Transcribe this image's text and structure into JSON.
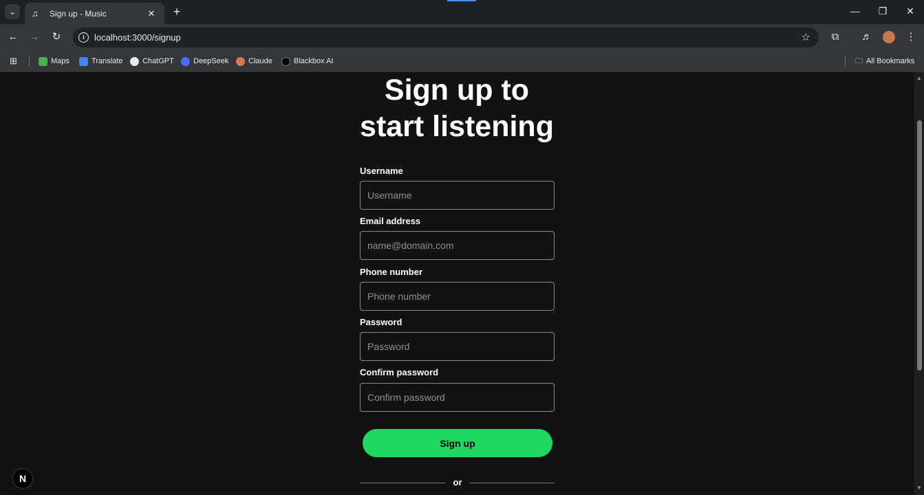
{
  "browser": {
    "tab": {
      "title": "Sign up - Music",
      "favicon": "music-note-icon"
    },
    "url": "localhost:3000/signup",
    "bookmarks": [
      {
        "label": "Maps",
        "icon": "maps-icon",
        "color": "#4caf50"
      },
      {
        "label": "Translate",
        "icon": "translate-icon",
        "color": "#4285f4"
      },
      {
        "label": "ChatGPT",
        "icon": "chatgpt-icon",
        "color": "#e8eaed"
      },
      {
        "label": "DeepSeek",
        "icon": "deepseek-icon",
        "color": "#4d6bfe"
      },
      {
        "label": "Claude",
        "icon": "claude-icon",
        "color": "#d97757"
      },
      {
        "label": "Blackbox AI",
        "icon": "blackbox-icon",
        "color": "#000000"
      }
    ],
    "all_bookmarks": "All Bookmarks"
  },
  "page": {
    "heading_line1": "Sign up to",
    "heading_line2": "start listening",
    "fields": [
      {
        "label": "Username",
        "placeholder": "Username",
        "value": ""
      },
      {
        "label": "Email address",
        "placeholder": "name@domain.com",
        "value": ""
      },
      {
        "label": "Phone number",
        "placeholder": "Phone number",
        "value": ""
      },
      {
        "label": "Password",
        "placeholder": "Password",
        "value": ""
      },
      {
        "label": "Confirm password",
        "placeholder": "Confirm password",
        "value": ""
      }
    ],
    "submit_label": "Sign up",
    "divider_text": "or",
    "dev_badge": "N",
    "accent_color": "#1ed760"
  }
}
